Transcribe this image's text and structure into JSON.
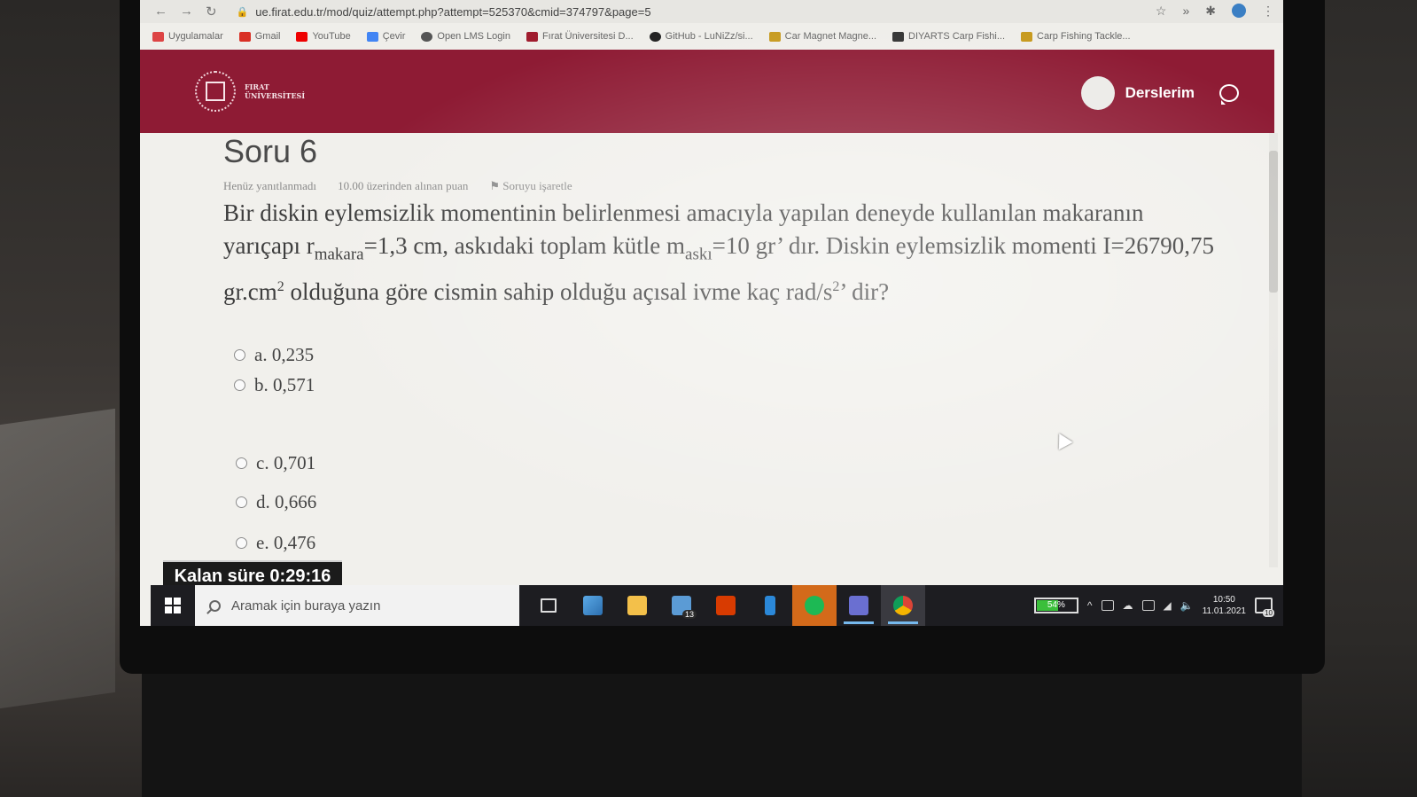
{
  "browser": {
    "url": "ue.firat.edu.tr/mod/quiz/attempt.php?attempt=525370&cmid=374797&page=5",
    "bookmarks": [
      {
        "label": "Uygulamalar",
        "icon": "apps-grid-icon",
        "color": "#d44"
      },
      {
        "label": "Gmail",
        "icon": "gmail-icon",
        "color": "#d93025"
      },
      {
        "label": "YouTube",
        "icon": "youtube-icon",
        "color": "#e00"
      },
      {
        "label": "Çevir",
        "icon": "translate-icon",
        "color": "#4285f4"
      },
      {
        "label": "Open LMS Login",
        "icon": "globe-icon",
        "color": "#555"
      },
      {
        "label": "Fırat Üniversitesi D...",
        "icon": "firat-icon",
        "color": "#a01c2e"
      },
      {
        "label": "GitHub - LuNiZz/si...",
        "icon": "github-icon",
        "color": "#222"
      },
      {
        "label": "Car Magnet Magne...",
        "icon": "bag-icon",
        "color": "#c79a1e"
      },
      {
        "label": "DIYARTS Carp Fishi...",
        "icon": "amazon-icon",
        "color": "#333"
      },
      {
        "label": "Carp Fishing Tackle...",
        "icon": "bag-icon",
        "color": "#c79a1e"
      }
    ]
  },
  "header": {
    "logo_line1": "FIRAT",
    "logo_line2": "ÜNİVERSİTESİ",
    "user_link": "Derslerim",
    "brand_color": "#8e1b34"
  },
  "question": {
    "title": "Soru 6",
    "status": "Henüz yanıtlanmadı",
    "points": "10.00 üzerinden alınan puan",
    "flag": "Soruyu işaretle",
    "text": {
      "p1": "Bir diskin eylemsizlik momentinin belirlenmesi amacıyla yapılan deneyde kullanılan makaranın yarıçapı r",
      "sub1": "makara",
      "p2": "=1,3 cm, askıdaki toplam kütle m",
      "sub2": "askı",
      "p3": "=10 gr’ dır. Diskin eylemsizlik momenti I=26790,75 gr.cm",
      "sup1": "2",
      "p4": " olduğuna göre cismin sahip olduğu açısal ivme kaç rad/s",
      "sup2": "2",
      "p5": "’ dir?"
    },
    "options": [
      {
        "label": "a. 0,235"
      },
      {
        "label": "b. 0,571"
      },
      {
        "label": "c. 0,701"
      },
      {
        "label": "d. 0,666"
      },
      {
        "label": "e. 0,476"
      }
    ]
  },
  "timer": {
    "label": "Kalan süre 0:29:16"
  },
  "taskbar": {
    "search_placeholder": "Aramak için buraya yazın",
    "mail_badge": "13",
    "battery_percent": "54%",
    "battery_level": 0.54,
    "time": "10:50",
    "date": "11.01.2021",
    "notif_count": "10"
  }
}
